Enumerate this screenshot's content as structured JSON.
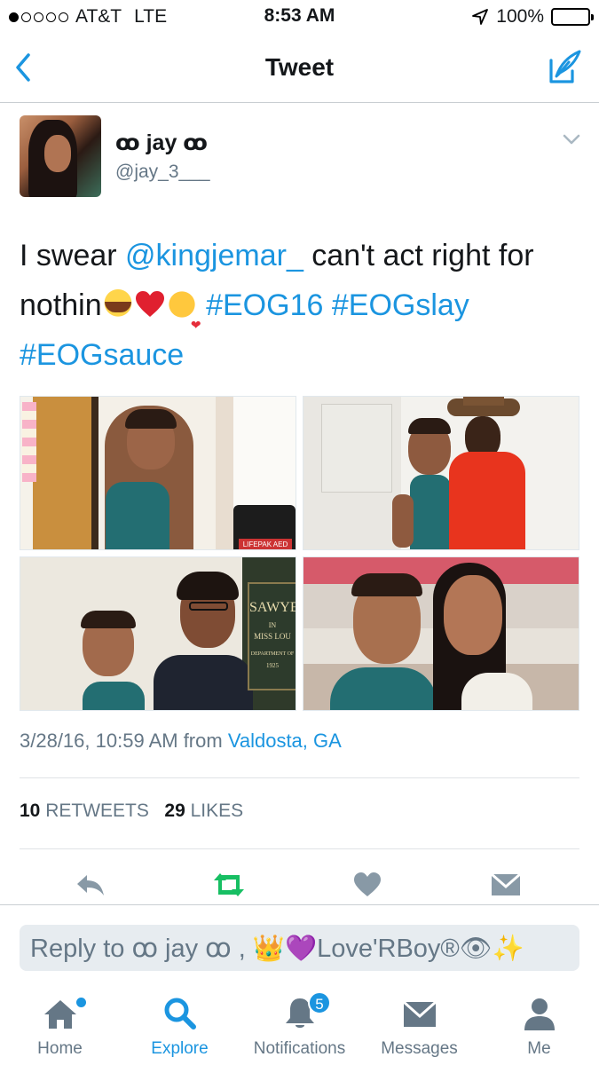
{
  "status_bar": {
    "carrier": "AT&T",
    "network": "LTE",
    "time": "8:53 AM",
    "battery": "100%",
    "signal_bars": 1
  },
  "nav": {
    "title": "Tweet",
    "back_icon": "chevron-left-icon",
    "compose_icon": "compose-tweet-icon"
  },
  "tweet": {
    "display_name": "ꝏ jay ꝏ",
    "handle": "@jay_3___",
    "text_parts": {
      "t1": "I swear ",
      "mention": "@kingjemar_",
      "t2": " can't act right for nothin",
      "tag1": "#EOG16",
      "tag2": "#EOGslay",
      "tag3": "#EOGsauce"
    },
    "emojis": [
      "face-with-tears-of-joy",
      "red-heart",
      "face-blowing-kiss"
    ],
    "timestamp": "3/28/16, 10:59 AM from ",
    "location": "Valdosta, GA",
    "retweets_count": "10",
    "retweets_label": "RETWEETS",
    "likes_count": "29",
    "likes_label": "LIKES"
  },
  "photo_signage": {
    "aed_label": "LIFEPAK AED",
    "plaque_l1": "SAWYE",
    "plaque_l2": "IN",
    "plaque_l3": "MISS LOU",
    "plaque_l4": "DEPARTMENT OF",
    "plaque_l5": "1925"
  },
  "reply_box": {
    "placeholder": "Reply to ꝏ jay ꝏ , 👑💜Love'RBoy®👁✨"
  },
  "tab_bar": [
    {
      "label": "Home",
      "icon": "home-icon",
      "has_dot": true
    },
    {
      "label": "Explore",
      "icon": "search-icon",
      "active": true
    },
    {
      "label": "Notifications",
      "icon": "bell-icon",
      "badge": "5"
    },
    {
      "label": "Messages",
      "icon": "envelope-icon"
    },
    {
      "label": "Me",
      "icon": "person-icon"
    }
  ],
  "colors": {
    "accent": "#1b95e0",
    "retweeted": "#17bf63",
    "muted": "#657786",
    "text": "#14171a"
  }
}
